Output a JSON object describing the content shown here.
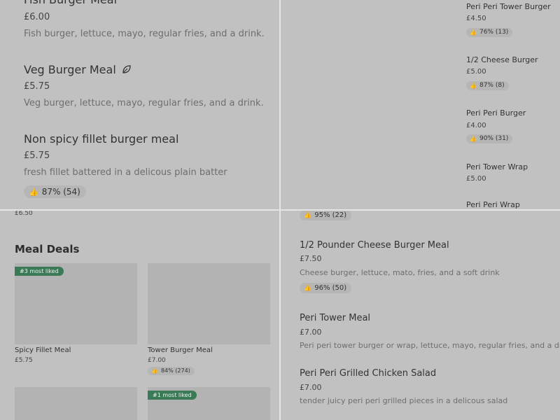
{
  "top_left": {
    "items": [
      {
        "title": "Fish Burger Meal",
        "price": "£6.00",
        "desc": "Fish burger, lettuce, mayo, regular fries, and a drink."
      },
      {
        "title": "Veg Burger Meal",
        "price": "£5.75",
        "desc": "Veg burger, lettuce, mayo, regular fries, and a drink.",
        "icon": "leaf-icon"
      },
      {
        "title": "Non spicy fillet burger meal",
        "price": "£5.75",
        "desc": "fresh fillet battered in a delicous plain batter",
        "rating": "87% (54)"
      }
    ]
  },
  "top_right": {
    "items": [
      {
        "title": "Peri Peri Tower Burger",
        "price": "£4.50",
        "rating": "76% (13)"
      },
      {
        "title": "1/2 Cheese Burger",
        "price": "£5.00",
        "rating": "87% (8)"
      },
      {
        "title": "Peri Peri Burger",
        "price": "£4.00",
        "rating": "90% (31)"
      },
      {
        "title": "Peri Tower Wrap",
        "price": "£5.00"
      },
      {
        "title": "Peri Peri Wrap"
      }
    ]
  },
  "bottom_left": {
    "top_price": "£6.50",
    "section_title": "Meal Deals",
    "cards": [
      {
        "title": "Spicy Fillet Meal",
        "price": "£5.75",
        "tag": "#3 most liked"
      },
      {
        "title": "Tower Burger Meal",
        "price": "£7.00",
        "rating": "84% (274)"
      },
      {
        "tag": "#1 most liked"
      }
    ]
  },
  "bottom_right": {
    "top_rating": "95% (22)",
    "items": [
      {
        "title": "1/2 Pounder Cheese Burger Meal",
        "price": "£7.50",
        "desc": "Cheese burger, lettuce, mato, fries, and a soft drink",
        "rating": "96% (50)"
      },
      {
        "title": "Peri Tower Meal",
        "price": "£7.00",
        "desc": "Peri peri tower burger or wrap, lettuce, mayo, regular fries, and a drink"
      },
      {
        "title": "Peri Peri Grilled Chicken Salad",
        "price": "£7.00",
        "desc": "tender juicy peri peri grilled pieces in a delicous salad"
      }
    ]
  },
  "colors": {
    "background": "#c1c1c1",
    "divider": "#e6e6e6",
    "accent": "#3b7a57"
  },
  "icons": {
    "thumb": "thumbs-up-icon",
    "leaf": "leaf-icon"
  }
}
